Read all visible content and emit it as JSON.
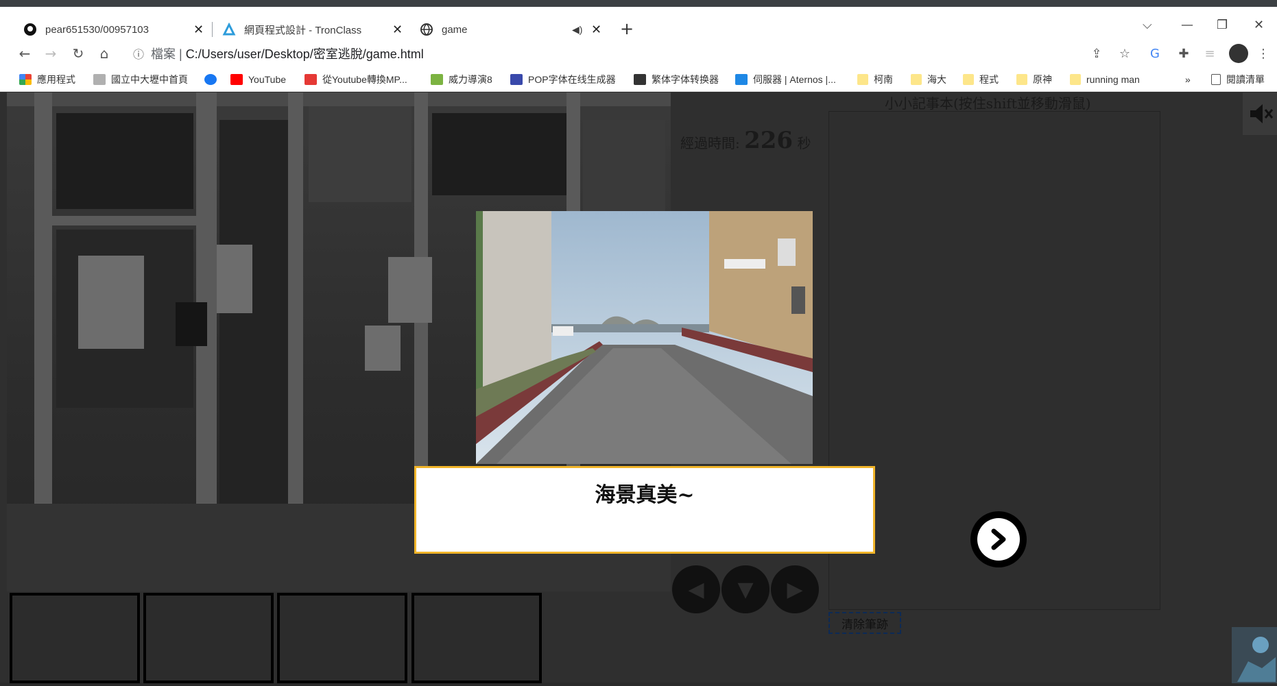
{
  "tabs": [
    {
      "label": "pear651530/00957103",
      "icon": "github-icon"
    },
    {
      "label": "網頁程式設計 - TronClass",
      "icon": "tronclass-icon"
    },
    {
      "label": "game",
      "icon": "globe-icon"
    }
  ],
  "address": {
    "prefix": "檔案",
    "url": "C:/Users/user/Desktop/密室逃脫/game.html"
  },
  "bookmarks": [
    {
      "label": "應用程式",
      "color": "#e8453c"
    },
    {
      "label": "國立中大壢中首頁",
      "color": "#9aa0a6"
    },
    {
      "label": "",
      "color": "#1877f2"
    },
    {
      "label": "YouTube",
      "color": "#ff0000"
    },
    {
      "label": "從Youtube轉換MP...",
      "color": "#e53935"
    },
    {
      "label": "威力導演8",
      "color": "#7cb342"
    },
    {
      "label": "POP字体在线生成器",
      "color": "#3949ab"
    },
    {
      "label": "繁体字体转换器",
      "color": "#333333"
    },
    {
      "label": "伺服器 | Aternos |...",
      "color": "#1e88e5"
    },
    {
      "label": "柯南",
      "color": "#fdd835"
    },
    {
      "label": "海大",
      "color": "#fdd835"
    },
    {
      "label": "程式",
      "color": "#fdd835"
    },
    {
      "label": "原神",
      "color": "#fdd835"
    },
    {
      "label": "running man",
      "color": "#fdd835"
    }
  ],
  "bookmarks_more": "»",
  "reading_list": "閱讀清單",
  "game": {
    "timer_label": "經過時間:",
    "timer_value": "226",
    "timer_unit": "秒",
    "notepad_title": "小小記事本(按住shift並移動滑鼠)",
    "clear_button": "清除筆跡",
    "dialog_text": "海景真美~"
  }
}
